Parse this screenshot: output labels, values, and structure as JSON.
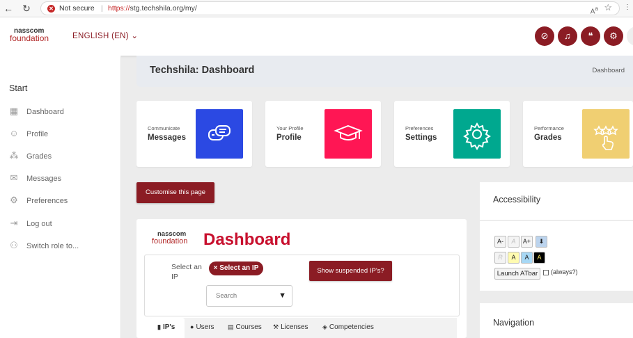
{
  "browser": {
    "security_label": "Not secure",
    "url_scheme": "https://",
    "url_rest": "stg.techshila.org/my/",
    "separator": "|"
  },
  "header": {
    "logo_line1": "nasscom",
    "logo_line2": "foundation",
    "language": "ENGLISH (EN) ⌄",
    "accent_color": "#8b1c24"
  },
  "sidebar": {
    "heading": "Start",
    "items": [
      {
        "label": "Dashboard",
        "icon": "dashboard-icon"
      },
      {
        "label": "Profile",
        "icon": "profile-icon"
      },
      {
        "label": "Grades",
        "icon": "grades-icon"
      },
      {
        "label": "Messages",
        "icon": "messages-icon"
      },
      {
        "label": "Preferences",
        "icon": "gear-icon"
      },
      {
        "label": "Log out",
        "icon": "logout-icon"
      },
      {
        "label": "Switch role to...",
        "icon": "switch-role-icon"
      }
    ]
  },
  "page": {
    "title": "Techshila: Dashboard",
    "breadcrumb": "Dashboard"
  },
  "cards": [
    {
      "sub": "Communicate",
      "title": "Messages",
      "color": "#2b49e3",
      "icon": "chat-icon"
    },
    {
      "sub": "Your Profile",
      "title": "Profile",
      "color": "#ff1654",
      "icon": "graduation-cap-icon"
    },
    {
      "sub": "Preferences",
      "title": "Settings",
      "color": "#00a88f",
      "icon": "gear-icon"
    },
    {
      "sub": "Performance",
      "title": "Grades",
      "color": "#f0cf72",
      "icon": "stars-hand-icon"
    }
  ],
  "customise_label": "Customise this page",
  "dashboard": {
    "logo_line1": "nasscom",
    "logo_line2": "foundation",
    "heading": "Dashboard",
    "select_label": "Select an IP",
    "chip_label": "× Select an IP",
    "suspended_button": "Show suspended IP's?",
    "search_placeholder": "Search",
    "tabs": [
      {
        "label": "IP's",
        "icon": "building-icon"
      },
      {
        "label": "Users",
        "icon": "user-icon"
      },
      {
        "label": "Courses",
        "icon": "course-icon"
      },
      {
        "label": "Licenses",
        "icon": "gavel-icon"
      },
      {
        "label": "Competencies",
        "icon": "cubes-icon"
      }
    ]
  },
  "accessibility": {
    "heading": "Accessibility",
    "row1": [
      "A-",
      "A",
      "A+"
    ],
    "row2": [
      "R",
      "A",
      "A",
      "A"
    ],
    "launch_label": "Launch ATbar",
    "always_label": "(always?)"
  },
  "navigation": {
    "heading": "Navigation"
  }
}
